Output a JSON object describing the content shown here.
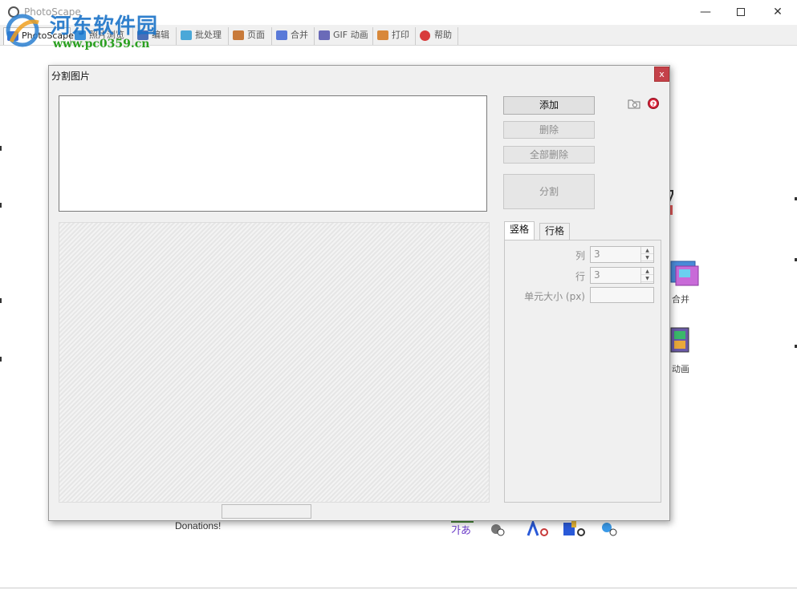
{
  "window": {
    "title": "PhotoScape",
    "minimize": "—",
    "close": "✕"
  },
  "watermark": {
    "site_name": "河东软件园",
    "url": "www.pc0359.cn"
  },
  "tabs": [
    {
      "label": "PhotoScape",
      "icon": "photoscape-icon",
      "color": "#3a6fd8"
    },
    {
      "label": "照片浏览",
      "icon": "viewer-icon",
      "color": "#3a8fd8"
    },
    {
      "label": "编辑",
      "icon": "editor-icon",
      "color": "#4a6fb8"
    },
    {
      "label": "批处理",
      "icon": "batch-icon",
      "color": "#4aa8d8"
    },
    {
      "label": "页面",
      "icon": "page-icon",
      "color": "#c87a3a"
    },
    {
      "label": "合并",
      "icon": "combine-icon",
      "color": "#5a7ad8"
    },
    {
      "label": "GIF 动画",
      "icon": "gif-icon",
      "color": "#6a6ab8"
    },
    {
      "label": "打印",
      "icon": "print-icon",
      "color": "#d8883a"
    },
    {
      "label": "帮助",
      "icon": "help-icon",
      "color": "#d83a3a"
    }
  ],
  "background": {
    "combine_label": "合并",
    "gif_label": "动画",
    "donations": "Donations!"
  },
  "dialog": {
    "title": "分割图片",
    "close": "x",
    "buttons": {
      "add": "添加",
      "delete": "删除",
      "delete_all": "全部删除",
      "split": "分割"
    },
    "tools": {
      "folder": "open-folder-icon",
      "help": "help-icon"
    },
    "option_tabs": [
      "竖格",
      "行格"
    ],
    "options": {
      "columns_label": "列",
      "columns_value": "3",
      "rows_label": "行",
      "rows_value": "3",
      "cell_size_label": "单元大小 (px)",
      "cell_size_value": ""
    },
    "colors": {
      "close_bg": "#c4414a",
      "disabled_text": "#8d8d8d"
    }
  }
}
